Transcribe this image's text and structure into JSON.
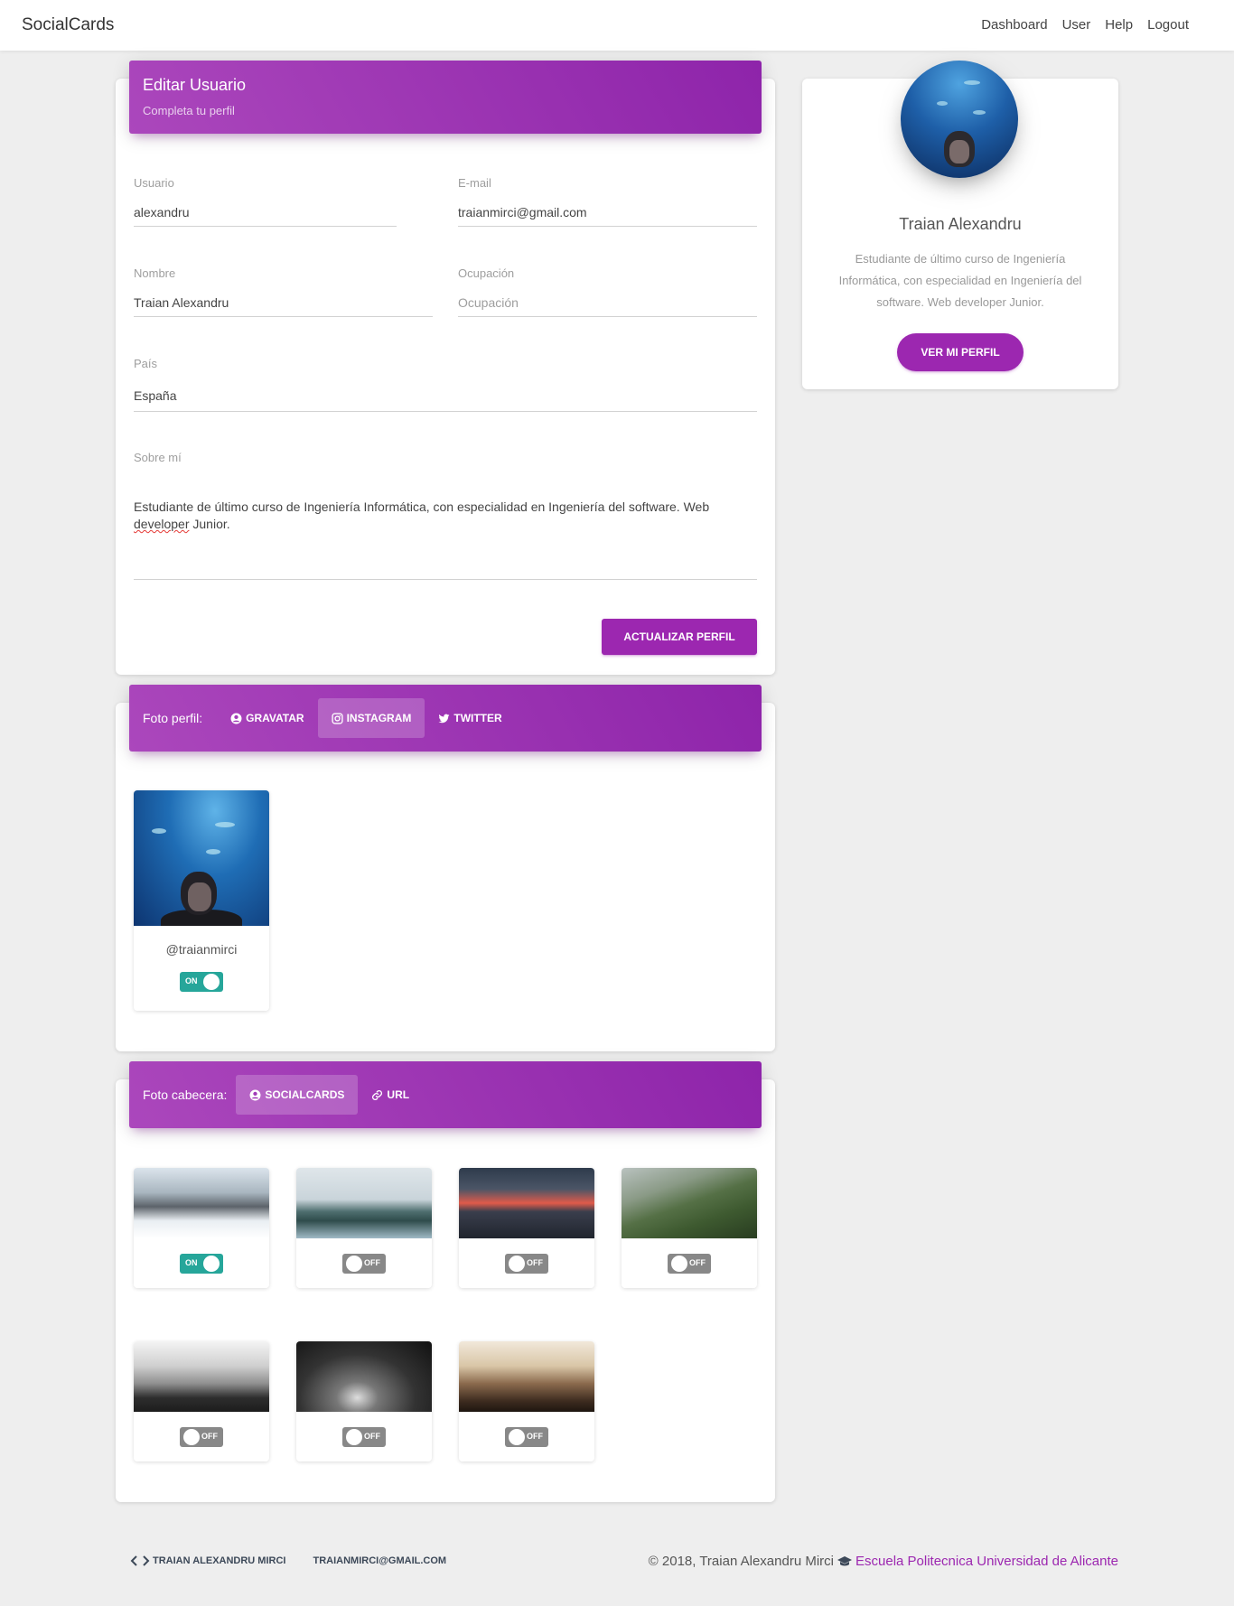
{
  "navbar": {
    "brand": "SocialCards",
    "links": [
      "Dashboard",
      "User",
      "Help",
      "Logout"
    ]
  },
  "edit_card": {
    "title": "Editar Usuario",
    "subtitle": "Completa tu perfil",
    "fields": {
      "username": {
        "label": "Usuario",
        "value": "alexandru"
      },
      "email": {
        "label": "E-mail",
        "value": "traianmirci@gmail.com"
      },
      "name": {
        "label": "Nombre",
        "value": "Traian Alexandru"
      },
      "occupation": {
        "label": "Ocupación",
        "value": "",
        "placeholder": "Ocupación"
      },
      "country": {
        "label": "País",
        "value": "España"
      },
      "about": {
        "label": "Sobre mí",
        "value_part1": "Estudiante de último curso de Ingeniería Informática, con especialidad en Ingeniería del software. Web",
        "value_misspelled": "developer",
        "value_part2": " Junior."
      }
    },
    "submit_label": "ACTUALIZAR PERFIL"
  },
  "profile_card": {
    "name": "Traian Alexandru",
    "description": "Estudiante de último curso de Ingeniería Informática, con especialidad en Ingeniería del software. Web developer Junior.",
    "button_label": "VER MI PERFIL"
  },
  "photo_card": {
    "label": "Foto perfil:",
    "tabs": [
      {
        "label": "GRAVATAR",
        "icon": "account-circle-icon",
        "active": false
      },
      {
        "label": "INSTAGRAM",
        "icon": "instagram-icon",
        "active": true
      },
      {
        "label": "TWITTER",
        "icon": "twitter-icon",
        "active": false
      }
    ],
    "instagram": {
      "handle": "@traianmirci",
      "toggle": "ON"
    }
  },
  "header_card": {
    "label": "Foto cabecera:",
    "tabs": [
      {
        "label": "SOCIALCARDS",
        "icon": "account-circle-icon",
        "active": true
      },
      {
        "label": "URL",
        "icon": "link-icon",
        "active": false
      }
    ],
    "images": [
      {
        "subject": "snowy-mountains",
        "toggle": "ON"
      },
      {
        "subject": "misty-forest-lake",
        "toggle": "OFF"
      },
      {
        "subject": "red-sunset-sea",
        "toggle": "OFF"
      },
      {
        "subject": "green-hills",
        "toggle": "OFF"
      },
      {
        "subject": "foggy-city-bw",
        "toggle": "OFF"
      },
      {
        "subject": "city-night-bw",
        "toggle": "OFF"
      },
      {
        "subject": "new-york-skyline",
        "toggle": "OFF"
      }
    ]
  },
  "footer": {
    "links": [
      "TRAIAN ALEXANDRU MIRCI",
      "TRAIANMIRCI@GMAIL.COM"
    ],
    "copyright": "© 2018, Traian Alexandru Mirci",
    "university": "Escuela Politecnica Universidad de Alicante"
  },
  "colors": {
    "accent": "#9c27b0",
    "toggle_on": "#26a69a",
    "toggle_off": "#888888",
    "background": "#eeeeee"
  }
}
